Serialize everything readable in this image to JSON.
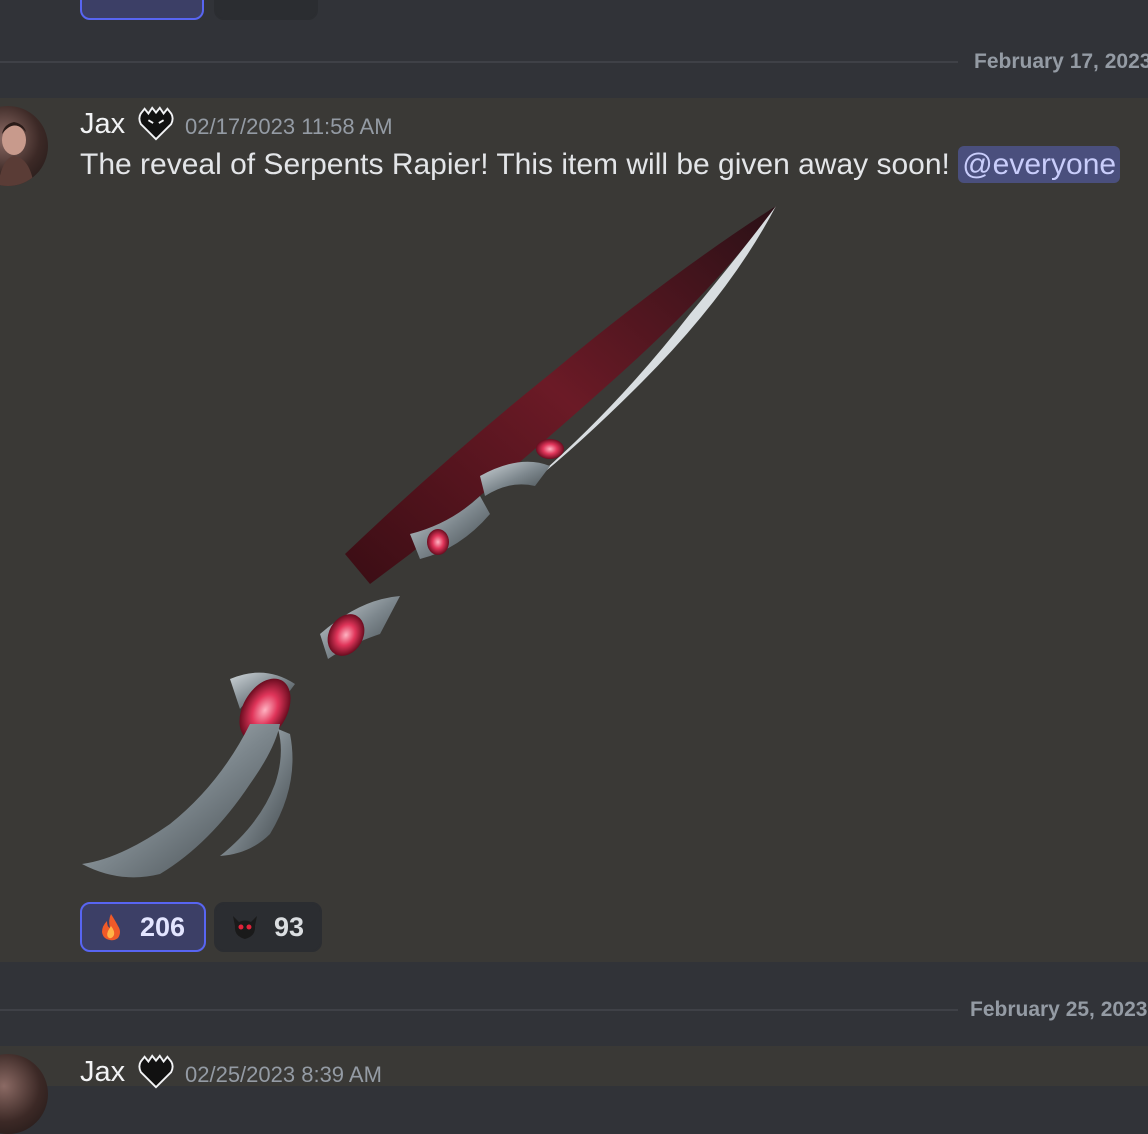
{
  "top_reactions": [
    {
      "count": ""
    },
    {
      "count": ""
    }
  ],
  "dividers": [
    {
      "date": "February 17, 2023"
    },
    {
      "date": "February 25, 2023"
    }
  ],
  "message": {
    "author": "Jax",
    "timestamp": "02/17/2023 11:58 AM",
    "text": "The reveal of Serpents Rapier! This item will be given away soon!",
    "mention": "@everyone",
    "attachment_icon": "serpent-rapier-image",
    "reactions": [
      {
        "emoji": "fire-icon",
        "count": "206",
        "active": true
      },
      {
        "emoji": "demon-icon",
        "count": "93",
        "active": false
      }
    ]
  },
  "next_message": {
    "author": "Jax",
    "timestamp": "02/25/2023 8:39 AM"
  },
  "colors": {
    "background": "#313338",
    "message_highlight": "#3a3936",
    "accent": "#5865f2",
    "mention_bg": "#4a4f7d",
    "muted": "#949ba4"
  }
}
